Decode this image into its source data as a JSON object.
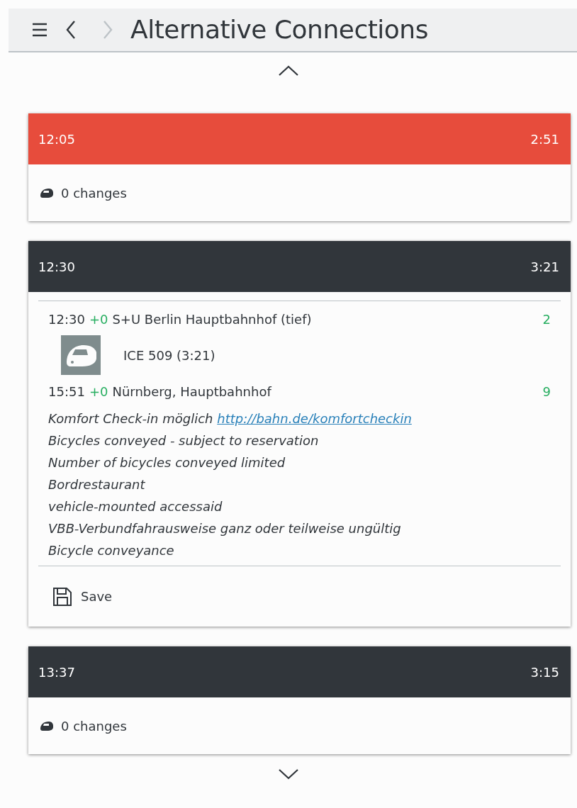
{
  "header": {
    "title": "Alternative Connections"
  },
  "journeys": [
    {
      "departure": "12:05",
      "duration": "2:51",
      "color": "#e74c3c",
      "expanded": false,
      "summary": "0 changes"
    },
    {
      "departure": "12:30",
      "duration": "3:21",
      "color": "#31363b",
      "expanded": true,
      "section": {
        "from": {
          "time": "12:30",
          "delay": "+0",
          "stop": "S+U Berlin Hauptbahnhof (tief)",
          "platform": "2"
        },
        "line": "ICE 509 (3:21)",
        "to": {
          "time": "15:51",
          "delay": "+0",
          "stop": "Nürnberg, Hauptbahnhof",
          "platform": "9"
        },
        "notes": [
          {
            "text": "Komfort Check-in möglich",
            "link": "http://bahn.de/komfortcheckin"
          },
          {
            "text": "Bicycles conveyed - subject to reservation"
          },
          {
            "text": "Number of bicycles conveyed limited"
          },
          {
            "text": "Bordrestaurant"
          },
          {
            "text": "vehicle-mounted accessaid"
          },
          {
            "text": "VBB-Verbundfahrausweise ganz oder teilweise ungültig"
          },
          {
            "text": "Bicycle conveyance"
          }
        ]
      },
      "action": "Save"
    },
    {
      "departure": "13:37",
      "duration": "3:15",
      "color": "#31363b",
      "expanded": false,
      "summary": "0 changes"
    }
  ]
}
